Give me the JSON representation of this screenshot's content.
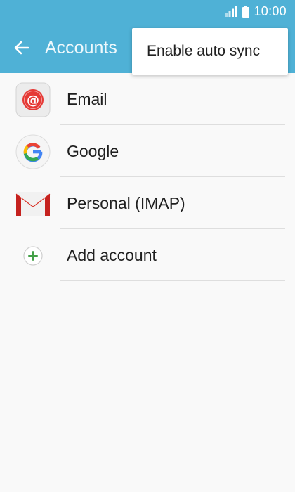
{
  "status_bar": {
    "time": "10:00",
    "icons": [
      "signal-icon",
      "battery-icon"
    ]
  },
  "app_bar": {
    "title": "Accounts",
    "back_icon": "back-arrow-icon",
    "background_color": "#4fb1d6"
  },
  "overflow_menu": {
    "items": [
      {
        "label": "Enable auto sync"
      }
    ]
  },
  "accounts": {
    "items": [
      {
        "label": "Email",
        "icon": "email-app-icon"
      },
      {
        "label": "Google",
        "icon": "google-icon"
      },
      {
        "label": "Personal (IMAP)",
        "icon": "gmail-icon"
      },
      {
        "label": "Add account",
        "icon": "add-icon"
      }
    ]
  }
}
